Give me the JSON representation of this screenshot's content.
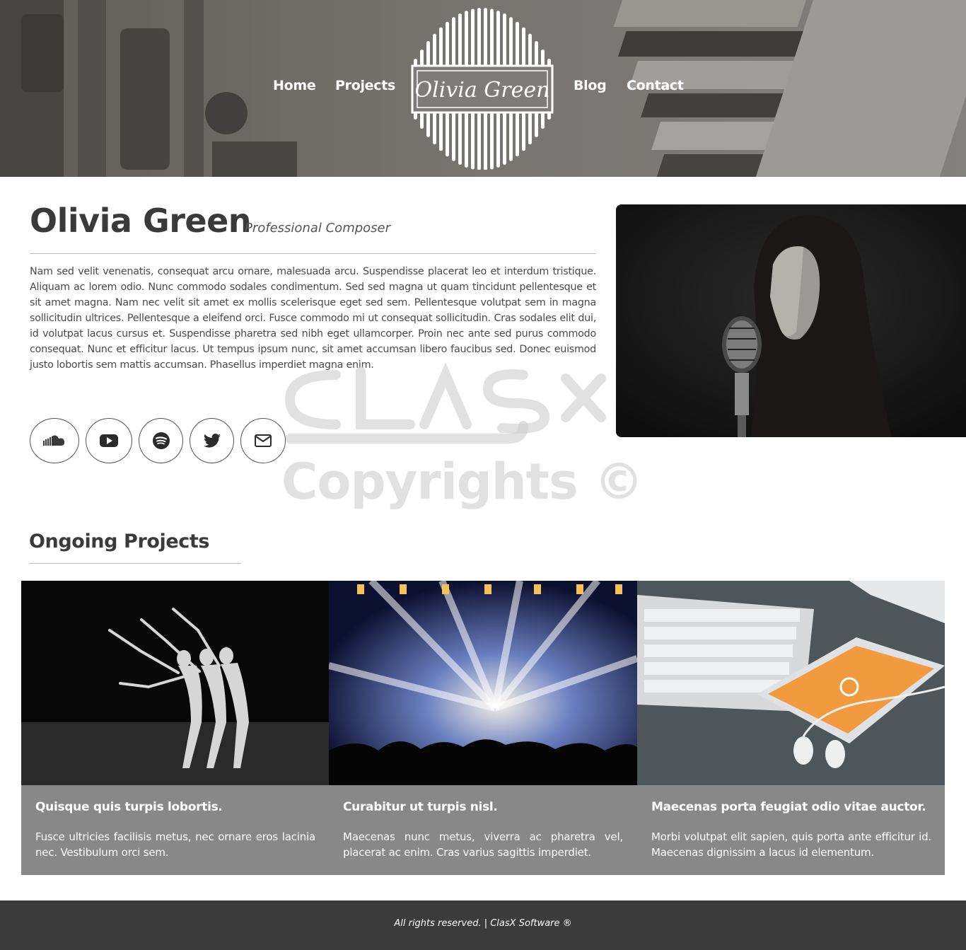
{
  "nav": {
    "home": "Home",
    "projects": "Projects",
    "blog": "Blog",
    "contact": "Contact"
  },
  "logo": {
    "text": "Olivia Green"
  },
  "intro": {
    "name": "Olivia Green",
    "subtitle": "Professional Composer",
    "bio": "Nam sed velit venenatis, consequat arcu ornare, malesuada arcu. Suspendisse placerat leo et interdum tristique. Aliquam ac lorem odio. Nunc commodo sodales condimentum. Sed sed magna ut quam tincidunt pellentesque et sit amet magna. Nam nec velit sit amet ex mollis scelerisque eget sed sem. Pellentesque volutpat sem in magna sollicitudin ultrices. Pellentesque a eleifend orci. Fusce commodo mi ut consequat sollicitudin. Cras sodales elit dui, id volutpat lacus cursus et. Suspendisse pharetra sed nibh eget ullamcorper. Proin nec ante sed purus commodo consequat. Nunc et efficitur lacus. Ut tempus ipsum nunc, sit amet accumsan libero faucibus sed. Donec euismod justo lobortis sem mattis accumsan. Phasellus imperdiet magna enim."
  },
  "social": [
    "soundcloud-icon",
    "youtube-icon",
    "spotify-icon",
    "twitter-icon",
    "envelope-icon"
  ],
  "watermark": {
    "text": "Copyrights ©"
  },
  "projects": {
    "heading": "Ongoing Projects",
    "cards": [
      {
        "title": "Quisque quis turpis lobortis.",
        "text": "Fusce ultricies facilisis metus, nec ornare eros lacinia nec. Vestibulum orci sem."
      },
      {
        "title": "Curabitur ut turpis nisl.",
        "text": "Maecenas nunc metus, viverra ac pharetra vel, placerat ac enim. Cras varius sagittis imperdiet."
      },
      {
        "title": "Maecenas porta feugiat odio vitae auctor.",
        "text": "Morbi volutpat elit sapien, quis porta ante efficitur id. Maecenas dignissim a lacus id elementum."
      }
    ]
  },
  "footer": {
    "text": "All rights reserved. | ClasX Software ®"
  },
  "colors": {
    "card_bg": "#888888",
    "footer_bg": "#3b3b3b",
    "heading": "#3a3a3a"
  }
}
